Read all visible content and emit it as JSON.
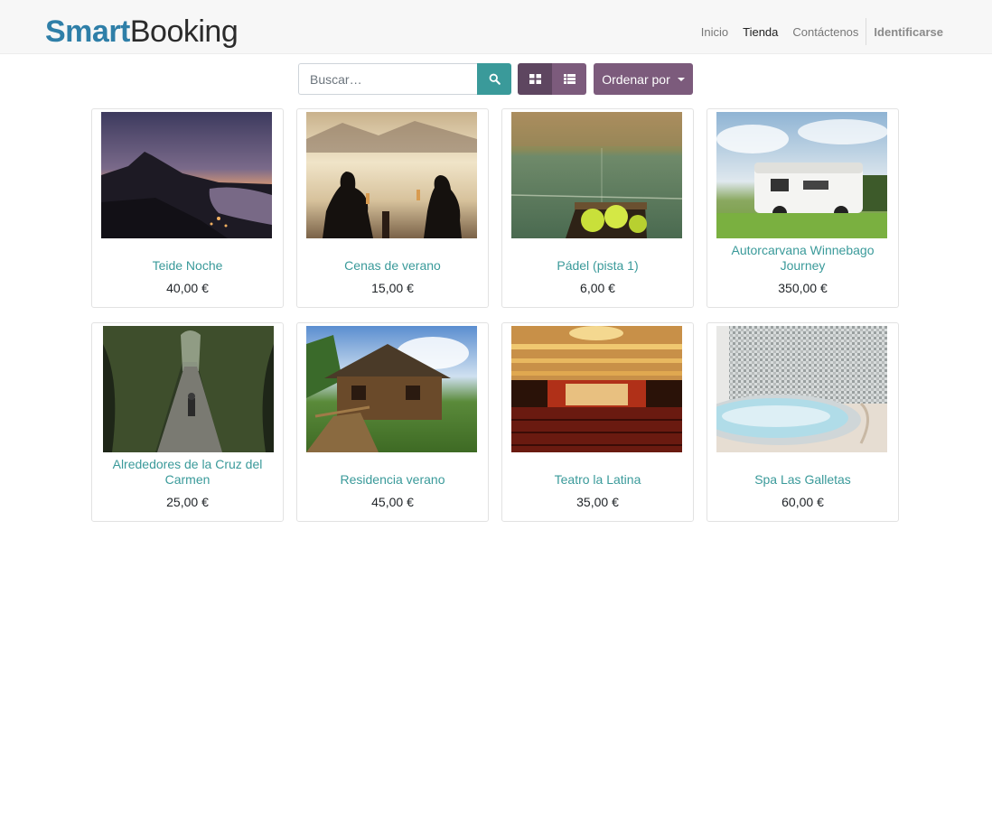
{
  "brand": {
    "smart": "Smart",
    "booking": "Booking"
  },
  "nav": {
    "items": [
      {
        "label": "Inicio",
        "active": false
      },
      {
        "label": "Tienda",
        "active": true
      },
      {
        "label": "Contáctenos",
        "active": false
      }
    ],
    "login": "Identificarse"
  },
  "toolbar": {
    "search_placeholder": "Buscar…",
    "search_value": "",
    "search_icon": "search-icon",
    "grid_view_icon": "grid-view-icon",
    "list_view_icon": "list-view-icon",
    "sort_label": "Ordenar por"
  },
  "colors": {
    "accent": "#3a9a9a",
    "primary": "#7c5b7c",
    "primary_dark": "#5e4660",
    "brand_blue": "#2f7fa8"
  },
  "products": [
    {
      "name": "Teide Noche",
      "price": "40,00 €",
      "image": "teide-night-photo"
    },
    {
      "name": "Cenas de verano",
      "price": "15,00 €",
      "image": "summer-dinner-photo"
    },
    {
      "name": "Pádel (pista 1)",
      "price": "6,00 €",
      "image": "padel-court-photo"
    },
    {
      "name": "Autorcarvana Winnebago Journey",
      "price": "350,00 €",
      "image": "motorhome-photo"
    },
    {
      "name": "Alrededores de la Cruz del Carmen",
      "price": "25,00 €",
      "image": "forest-path-photo"
    },
    {
      "name": "Residencia verano",
      "price": "45,00 €",
      "image": "log-cabin-photo"
    },
    {
      "name": "Teatro la Latina",
      "price": "35,00 €",
      "image": "theater-photo"
    },
    {
      "name": "Spa Las Galletas",
      "price": "60,00 €",
      "image": "spa-jacuzzi-photo"
    }
  ]
}
